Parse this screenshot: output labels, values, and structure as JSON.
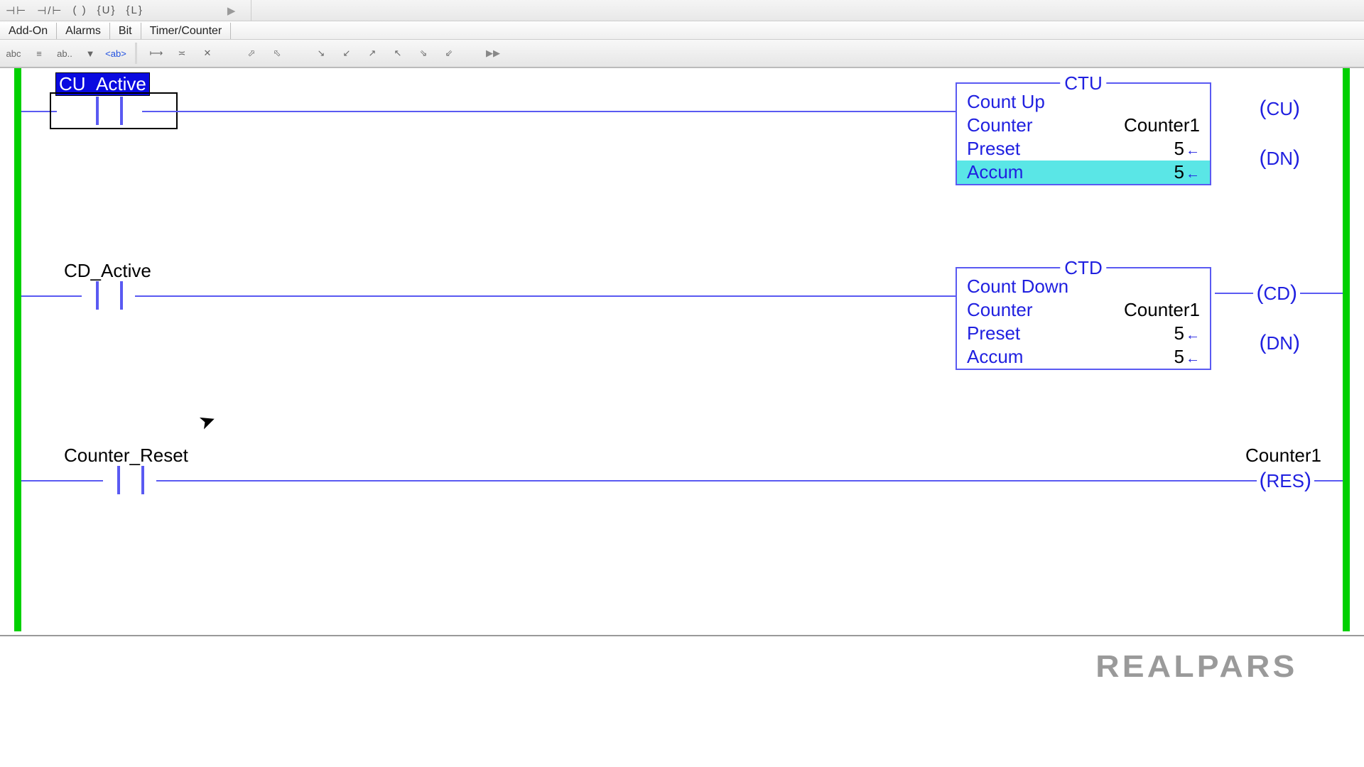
{
  "topglyphs": [
    "⊣⊢",
    "⊣/⊢",
    "( )",
    "{U}",
    "{L}"
  ],
  "tabs": [
    "Add-On",
    "Alarms",
    "Bit",
    "Timer/Counter"
  ],
  "rungs": {
    "r1": {
      "contact_label": "CU_Active",
      "block_title": "CTU",
      "block_name": "Count Up",
      "counter_label": "Counter",
      "counter_value": "Counter1",
      "preset_label": "Preset",
      "preset_value": "5",
      "accum_label": "Accum",
      "accum_value": "5",
      "out1": "CU",
      "out2": "DN"
    },
    "r2": {
      "contact_label": "CD_Active",
      "block_title": "CTD",
      "block_name": "Count Down",
      "counter_label": "Counter",
      "counter_value": "Counter1",
      "preset_label": "Preset",
      "preset_value": "5",
      "accum_label": "Accum",
      "accum_value": "5",
      "out1": "CD",
      "out2": "DN"
    },
    "r3": {
      "contact_label": "Counter_Reset",
      "out_label_top": "Counter1",
      "out_coil": "RES"
    }
  },
  "watermark": "REALPARS"
}
